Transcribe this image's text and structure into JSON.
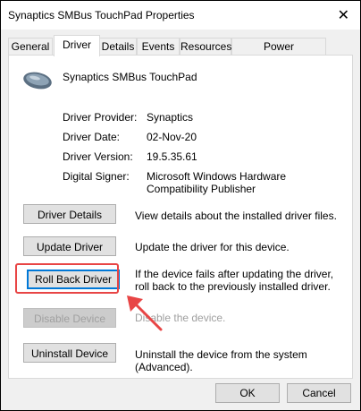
{
  "window": {
    "title": "Synaptics SMBus TouchPad Properties",
    "close_label": "✕"
  },
  "tabs": [
    {
      "label": "General"
    },
    {
      "label": "Driver"
    },
    {
      "label": "Details"
    },
    {
      "label": "Events"
    },
    {
      "label": "Resources"
    },
    {
      "label": "Power Management"
    }
  ],
  "device": {
    "name": "Synaptics SMBus TouchPad",
    "icon": "touchpad-icon"
  },
  "info": {
    "provider_label": "Driver Provider:",
    "provider_value": "Synaptics",
    "date_label": "Driver Date:",
    "date_value": "02-Nov-20",
    "version_label": "Driver Version:",
    "version_value": "19.5.35.61",
    "signer_label": "Digital Signer:",
    "signer_value": "Microsoft Windows Hardware Compatibility Publisher"
  },
  "actions": [
    {
      "label": "Driver Details",
      "desc": "View details about the installed driver files."
    },
    {
      "label": "Update Driver",
      "desc": "Update the driver for this device."
    },
    {
      "label": "Roll Back Driver",
      "desc": "If the device fails after updating the driver, roll back to the previously installed driver."
    },
    {
      "label": "Disable Device",
      "desc": "Disable the device."
    },
    {
      "label": "Uninstall Device",
      "desc": "Uninstall the device from the system (Advanced)."
    }
  ],
  "footer": {
    "ok_label": "OK",
    "cancel_label": "Cancel"
  },
  "colors": {
    "annotation": "#e84545",
    "focus": "#0078d7"
  }
}
